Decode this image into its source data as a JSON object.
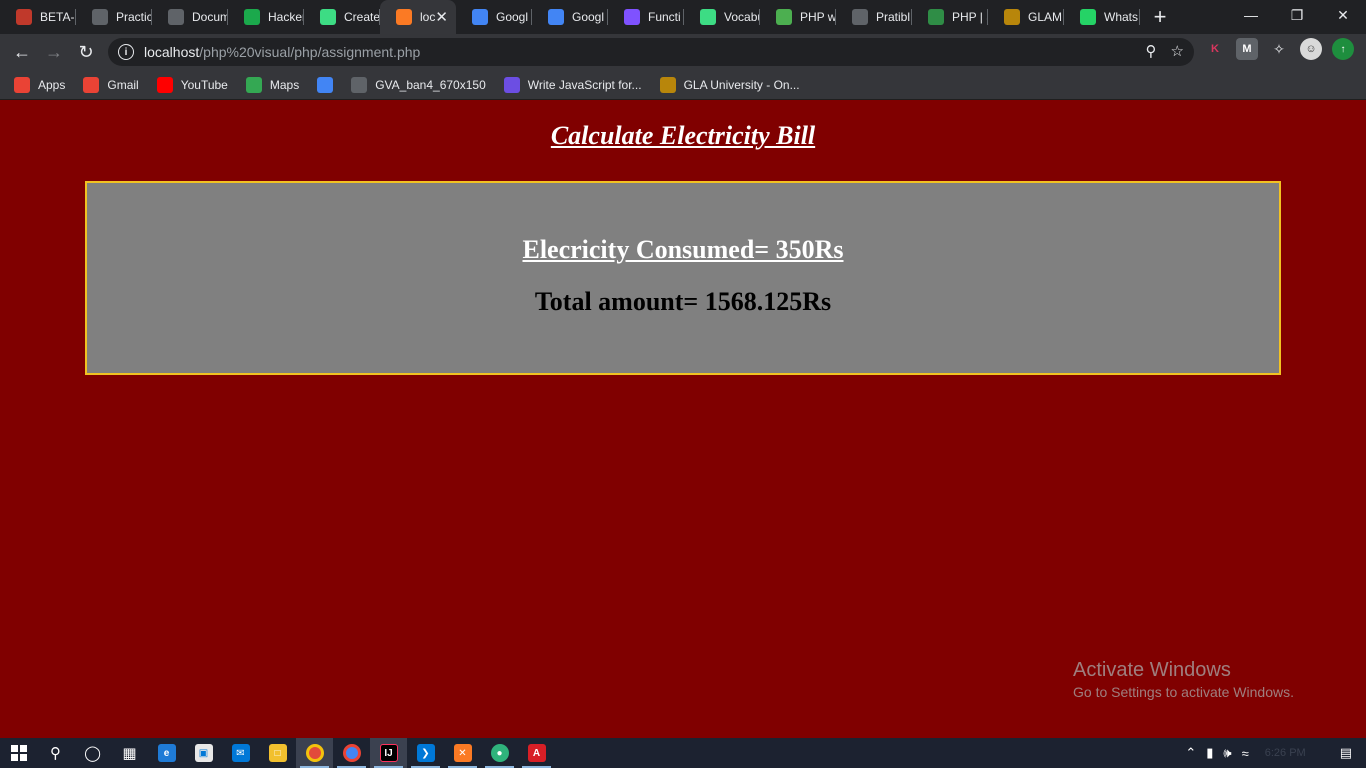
{
  "browser": {
    "tabs": [
      {
        "label": "BETA-L",
        "icon": "beta-icon",
        "color": "#c0392b"
      },
      {
        "label": "Practic",
        "icon": "globe-icon",
        "color": "#5f6368"
      },
      {
        "label": "Docum",
        "icon": "globe-icon",
        "color": "#5f6368"
      },
      {
        "label": "Hacker",
        "icon": "hackerrank-icon",
        "color": "#1ba94c"
      },
      {
        "label": "Create",
        "icon": "android-icon",
        "color": "#3ddc84"
      },
      {
        "label": "loc",
        "icon": "xampp-icon",
        "color": "#fb7a24",
        "active": true
      },
      {
        "label": "Googl",
        "icon": "google-icon",
        "color": "#4285f4"
      },
      {
        "label": "Googl",
        "icon": "google-icon",
        "color": "#4285f4"
      },
      {
        "label": "Functi",
        "icon": "kotlin-icon",
        "color": "#7f52ff"
      },
      {
        "label": "Vocabu",
        "icon": "android-icon",
        "color": "#3ddc84"
      },
      {
        "label": "PHP w",
        "icon": "w3schools-icon",
        "color": "#4caf50"
      },
      {
        "label": "Pratibl",
        "icon": "github-icon",
        "color": "#5f6368"
      },
      {
        "label": "PHP | S",
        "icon": "geeksforgeeks-icon",
        "color": "#2f8d46"
      },
      {
        "label": "GLAM",
        "icon": "gla-icon",
        "color": "#b8860b"
      },
      {
        "label": "Whats",
        "icon": "whatsapp-icon",
        "color": "#25d366"
      }
    ],
    "url_host": "localhost",
    "url_path": "/php%20visual/php/assignment.php",
    "bookmarks": [
      {
        "label": "Apps",
        "icon": "apps-grid-icon",
        "color": "#ea4335"
      },
      {
        "label": "Gmail",
        "icon": "gmail-icon",
        "color": "#ea4335"
      },
      {
        "label": "YouTube",
        "icon": "youtube-icon",
        "color": "#ff0000"
      },
      {
        "label": "Maps",
        "icon": "maps-icon",
        "color": "#34a853"
      },
      {
        "label": "",
        "icon": "google-icon",
        "color": "#4285f4"
      },
      {
        "label": "GVA_ban4_670x150",
        "icon": "globe-icon",
        "color": "#5f6368"
      },
      {
        "label": "Write JavaScript for...",
        "icon": "codedamn-icon",
        "color": "#6c4ee3"
      },
      {
        "label": "GLA University - On...",
        "icon": "gla-icon",
        "color": "#b8860b"
      }
    ]
  },
  "page": {
    "title": "Calculate Electricity Bill",
    "consumed_text": "Elecricity Consumed= 350Rs",
    "total_text": "Total amount= 1568.125Rs",
    "background_color": "#800000",
    "box_color": "#808080",
    "box_border_color": "#f2c222"
  },
  "watermark": {
    "title": "Activate Windows",
    "subtitle": "Go to Settings to activate Windows."
  },
  "taskbar": {
    "clock": "6:26 PM"
  }
}
